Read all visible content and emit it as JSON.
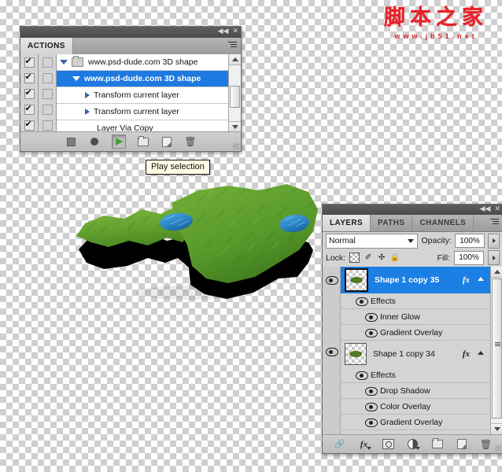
{
  "watermark": {
    "cn_text": "脚本之家",
    "url": "www.jb51.net",
    "color": "#e8222a"
  },
  "artwork": {
    "name": "3d-grass-island-shape",
    "description": "3D extruded grass-textured landmass with two blue lakes",
    "grass_color": "#6faa33",
    "grass_dark": "#4c7f23",
    "extrude_color": "#000000",
    "lake_color": "#2f8fd4"
  },
  "actions_panel": {
    "title_controls": {
      "collapse": "◀◀",
      "close": "✕"
    },
    "tab_label": "ACTIONS",
    "menu_icon": "panel-menu-icon",
    "columns": {
      "toggle": "toggle-on-off",
      "dialog": "toggle-dialog"
    },
    "rows": [
      {
        "id": "row-set",
        "label": "www.psd-dude.com 3D shape",
        "checked": true,
        "dialog": false,
        "disclosure": "down",
        "icon": "folder-icon",
        "indent": 0,
        "selected": false
      },
      {
        "id": "row-action",
        "label": "www.psd-dude.com 3D shape",
        "checked": true,
        "dialog": false,
        "disclosure": "down",
        "icon": "none",
        "indent": 1,
        "selected": true
      },
      {
        "id": "row-cmd-1",
        "label": "Transform current layer",
        "checked": true,
        "dialog": false,
        "disclosure": "right",
        "icon": "none",
        "indent": 2,
        "selected": false
      },
      {
        "id": "row-cmd-2",
        "label": "Transform current layer",
        "checked": true,
        "dialog": false,
        "disclosure": "right",
        "icon": "none",
        "indent": 2,
        "selected": false
      },
      {
        "id": "row-cmd-3",
        "label": "Layer Via Copy",
        "checked": true,
        "dialog": false,
        "disclosure": "none",
        "icon": "none",
        "indent": 2,
        "selected": false
      }
    ],
    "footer_buttons": [
      {
        "name": "stop-button",
        "icon": "stop-icon",
        "pressed": false
      },
      {
        "name": "record-button",
        "icon": "record-icon",
        "pressed": false
      },
      {
        "name": "play-selection-button",
        "icon": "play-icon",
        "pressed": true
      },
      {
        "name": "new-set-button",
        "icon": "folder-icon",
        "pressed": false
      },
      {
        "name": "new-action-button",
        "icon": "new-document-icon",
        "pressed": false
      },
      {
        "name": "delete-button",
        "icon": "trash-icon",
        "pressed": false
      }
    ]
  },
  "tooltip": {
    "text": "Play selection"
  },
  "layers_panel": {
    "title_controls": {
      "collapse": "◀◀",
      "close": "✕"
    },
    "tabs": [
      {
        "label": "LAYERS",
        "active": true
      },
      {
        "label": "PATHS",
        "active": false
      },
      {
        "label": "CHANNELS",
        "active": false
      }
    ],
    "menu_icon": "panel-menu-icon",
    "blend_mode": {
      "value": "Normal",
      "caret": "chevron-down-icon"
    },
    "opacity": {
      "label": "Opacity:",
      "value": "100%"
    },
    "fill": {
      "label": "Fill:",
      "value": "100%"
    },
    "lock": {
      "label": "Lock:",
      "items": [
        {
          "name": "lock-transparent-pixels-icon",
          "glyph": "checker"
        },
        {
          "name": "lock-image-pixels-icon",
          "glyph": "✐"
        },
        {
          "name": "lock-position-icon",
          "glyph": "✛"
        },
        {
          "name": "lock-all-icon",
          "glyph": "🔒"
        }
      ]
    },
    "layers": [
      {
        "name": "Shape 1 copy 35",
        "selected": true,
        "visible": true,
        "has_fx": true,
        "fx_badge": "fx",
        "effects_label": "Effects",
        "effects": [
          "Inner Glow",
          "Gradient Overlay"
        ]
      },
      {
        "name": "Shape 1 copy 34",
        "selected": false,
        "visible": true,
        "has_fx": true,
        "fx_badge": "fx",
        "effects_label": "Effects",
        "effects": [
          "Drop Shadow",
          "Color Overlay",
          "Gradient Overlay"
        ]
      }
    ],
    "footer_buttons": [
      {
        "name": "link-layers-button",
        "icon": "link-icon"
      },
      {
        "name": "layer-style-button",
        "icon": "fx-icon"
      },
      {
        "name": "add-layer-mask-button",
        "icon": "mask-icon"
      },
      {
        "name": "adjustment-layer-button",
        "icon": "adjustment-icon"
      },
      {
        "name": "new-group-button",
        "icon": "folder-icon"
      },
      {
        "name": "new-layer-button",
        "icon": "new-document-icon"
      },
      {
        "name": "delete-layer-button",
        "icon": "trash-icon"
      }
    ]
  }
}
